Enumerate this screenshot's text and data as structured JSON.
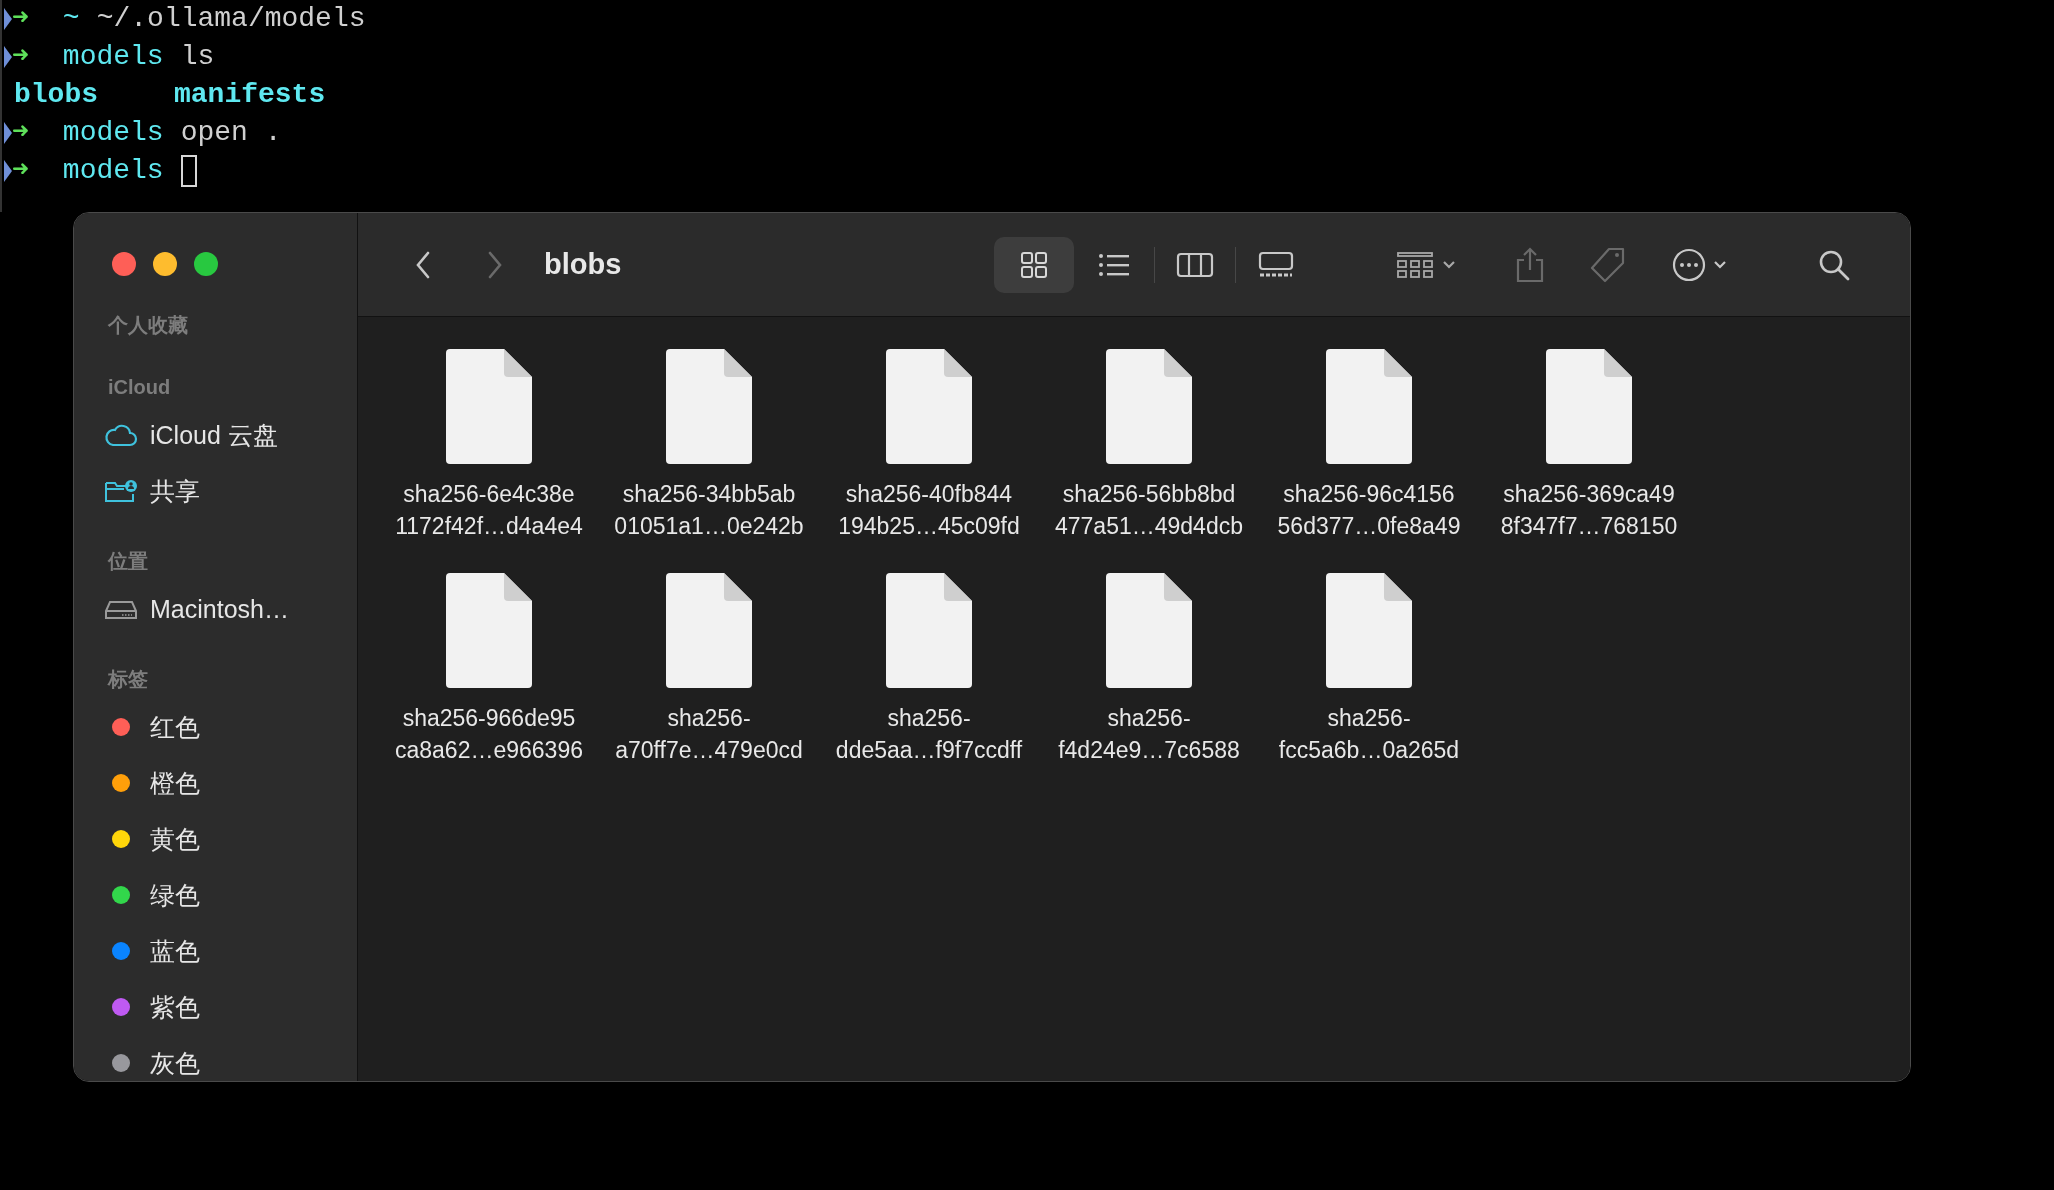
{
  "terminal": {
    "lines": [
      {
        "kind": "prompt",
        "arrow": "➜",
        "dir": "~",
        "command": "~/.ollama/models"
      },
      {
        "kind": "prompt",
        "arrow": "➜",
        "dir": "models",
        "command": "ls"
      },
      {
        "kind": "output",
        "items": [
          "blobs",
          "manifests"
        ]
      },
      {
        "kind": "prompt",
        "arrow": "➜",
        "dir": "models",
        "command": "open ."
      },
      {
        "kind": "prompt",
        "arrow": "➜",
        "dir": "models",
        "cursor": true
      }
    ]
  },
  "finder": {
    "sidebar": {
      "sections": [
        {
          "heading": "个人收藏"
        },
        {
          "heading": "iCloud",
          "items": [
            {
              "kind": "icloud",
              "label": "iCloud 云盘"
            },
            {
              "kind": "shared",
              "label": "共享"
            }
          ]
        },
        {
          "heading": "位置",
          "items": [
            {
              "kind": "disk",
              "label": "Macintosh…"
            }
          ]
        },
        {
          "heading": "标签",
          "items": [
            {
              "kind": "tag",
              "label": "红色",
              "color": "#fe5f57"
            },
            {
              "kind": "tag",
              "label": "橙色",
              "color": "#ff9f0a"
            },
            {
              "kind": "tag",
              "label": "黄色",
              "color": "#ffd60a"
            },
            {
              "kind": "tag",
              "label": "绿色",
              "color": "#32d74b"
            },
            {
              "kind": "tag",
              "label": "蓝色",
              "color": "#0a84ff"
            },
            {
              "kind": "tag",
              "label": "紫色",
              "color": "#bf5af2"
            },
            {
              "kind": "tag",
              "label": "灰色",
              "color": "#98989d"
            }
          ]
        }
      ]
    },
    "toolbar": {
      "title": "blobs",
      "views": [
        {
          "kind": "icons",
          "selected": true
        },
        {
          "kind": "list",
          "selected": false
        },
        {
          "kind": "columns",
          "selected": false
        },
        {
          "kind": "gallery",
          "selected": false
        }
      ]
    },
    "files": [
      {
        "name_lines": [
          "sha256-6e4c38e",
          "1172f42f…d4a4e4"
        ]
      },
      {
        "name_lines": [
          "sha256-34bb5ab",
          "01051a1…0e242b"
        ]
      },
      {
        "name_lines": [
          "sha256-40fb844",
          "194b25…45c09fd"
        ]
      },
      {
        "name_lines": [
          "sha256-56bb8bd",
          "477a51…49d4dcb"
        ]
      },
      {
        "name_lines": [
          "sha256-96c4156",
          "56d377…0fe8a49"
        ]
      },
      {
        "name_lines": [
          "sha256-369ca49",
          "8f347f7…768150"
        ]
      },
      {
        "name_lines": [
          "sha256-966de95",
          "ca8a62…e966396"
        ]
      },
      {
        "name_lines": [
          "sha256-",
          "a70ff7e…479e0cd"
        ]
      },
      {
        "name_lines": [
          "sha256-",
          "dde5aa…f9f7ccdff"
        ]
      },
      {
        "name_lines": [
          "sha256-",
          "f4d24e9…7c6588"
        ]
      },
      {
        "name_lines": [
          "sha256-",
          "fcc5a6b…0a265d"
        ]
      }
    ]
  }
}
